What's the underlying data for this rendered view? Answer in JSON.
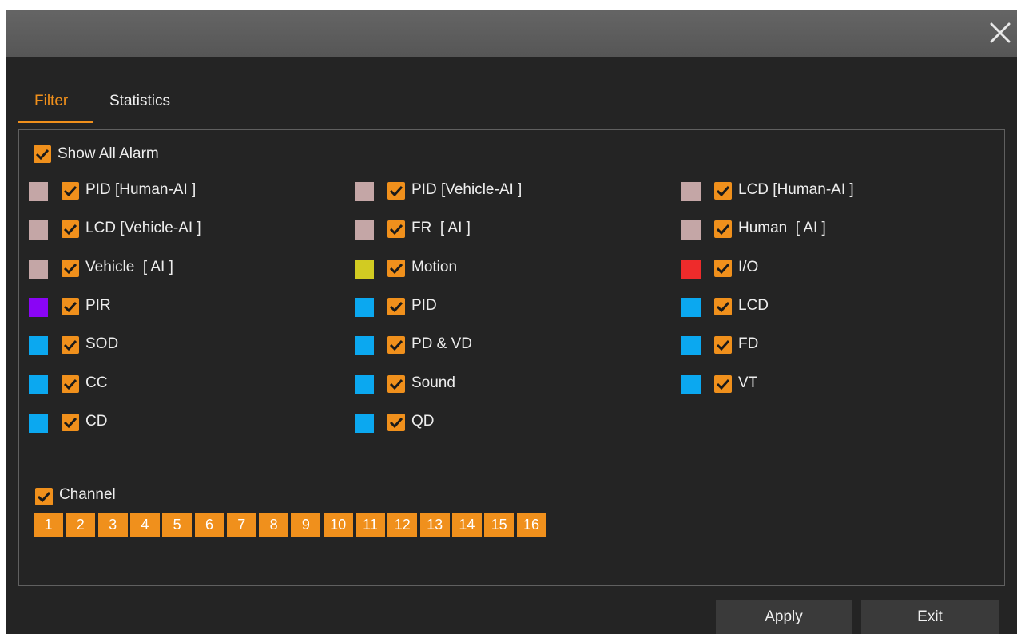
{
  "dialog": {
    "close_icon": "close-icon"
  },
  "tabs": [
    {
      "label": "Filter",
      "active": true
    },
    {
      "label": "Statistics",
      "active": false
    }
  ],
  "show_all": {
    "label": "Show All Alarm",
    "checked": true
  },
  "alarm_types": [
    {
      "label": "PID [Human-AI ]",
      "color": "#c4a6a6",
      "checked": true
    },
    {
      "label": "PID [Vehicle-AI ]",
      "color": "#c4a6a6",
      "checked": true
    },
    {
      "label": "LCD [Human-AI ]",
      "color": "#c4a6a6",
      "checked": true
    },
    {
      "label": "LCD [Vehicle-AI ]",
      "color": "#c4a6a6",
      "checked": true
    },
    {
      "label": "FR  [ AI ]",
      "color": "#c4a6a6",
      "checked": true
    },
    {
      "label": "Human  [ AI ]",
      "color": "#c4a6a6",
      "checked": true
    },
    {
      "label": "Vehicle  [ AI ]",
      "color": "#c4a6a6",
      "checked": true
    },
    {
      "label": "Motion",
      "color": "#d2cb22",
      "checked": true
    },
    {
      "label": "I/O",
      "color": "#ee2b2b",
      "checked": true
    },
    {
      "label": "PIR",
      "color": "#8a05f5",
      "checked": true
    },
    {
      "label": "PID",
      "color": "#0ba8f0",
      "checked": true
    },
    {
      "label": "LCD",
      "color": "#0ba8f0",
      "checked": true
    },
    {
      "label": "SOD",
      "color": "#0ba8f0",
      "checked": true
    },
    {
      "label": "PD & VD",
      "color": "#0ba8f0",
      "checked": true
    },
    {
      "label": "FD",
      "color": "#0ba8f0",
      "checked": true
    },
    {
      "label": "CC",
      "color": "#0ba8f0",
      "checked": true
    },
    {
      "label": "Sound",
      "color": "#0ba8f0",
      "checked": true
    },
    {
      "label": "VT",
      "color": "#0ba8f0",
      "checked": true
    },
    {
      "label": "CD",
      "color": "#0ba8f0",
      "checked": true
    },
    {
      "label": "QD",
      "color": "#0ba8f0",
      "checked": true
    }
  ],
  "channel": {
    "label": "Channel",
    "checked": true,
    "numbers": [
      "1",
      "2",
      "3",
      "4",
      "5",
      "6",
      "7",
      "8",
      "9",
      "10",
      "11",
      "12",
      "13",
      "14",
      "15",
      "16"
    ]
  },
  "footer": {
    "apply_label": "Apply",
    "exit_label": "Exit"
  },
  "colors": {
    "accent": "#f0901c",
    "background": "#242424",
    "titlebar": "#5e5e5e"
  }
}
